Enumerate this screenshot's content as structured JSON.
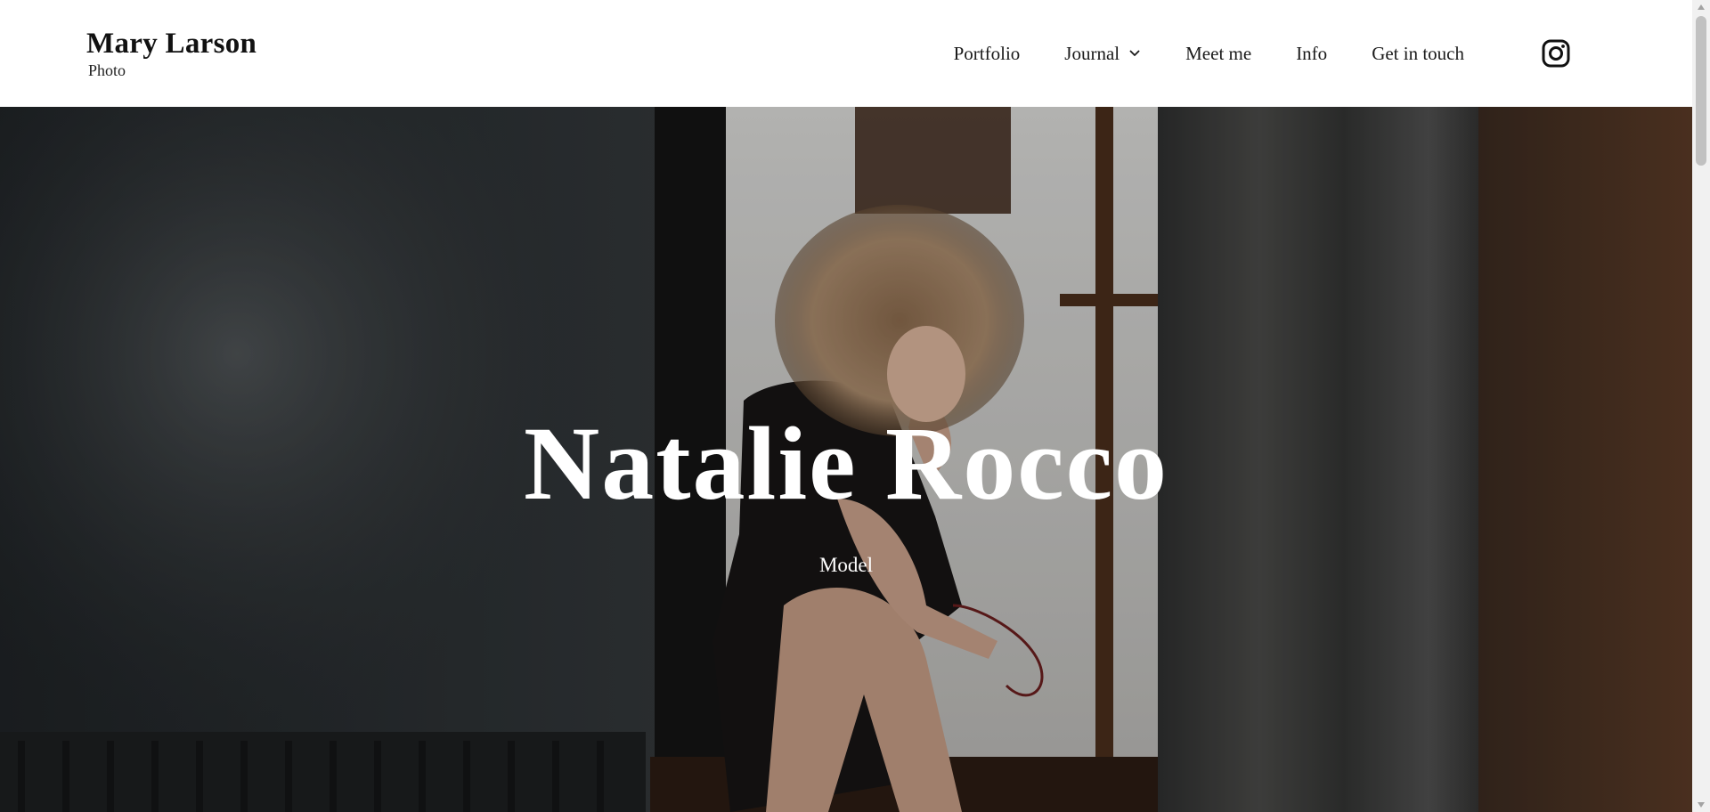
{
  "brand": {
    "name": "Mary Larson",
    "tagline": "Photo"
  },
  "nav": {
    "items": [
      {
        "label": "Portfolio"
      },
      {
        "label": "Journal",
        "has_dropdown": true
      },
      {
        "label": "Meet me"
      },
      {
        "label": "Info"
      },
      {
        "label": "Get in touch"
      }
    ],
    "social_icon": "instagram-icon"
  },
  "hero": {
    "title": "Natalie Rocco",
    "subtitle": "Model"
  },
  "colors": {
    "header_bg": "#ffffff",
    "text": "#1a1a1a",
    "hero_text": "#ffffff"
  }
}
